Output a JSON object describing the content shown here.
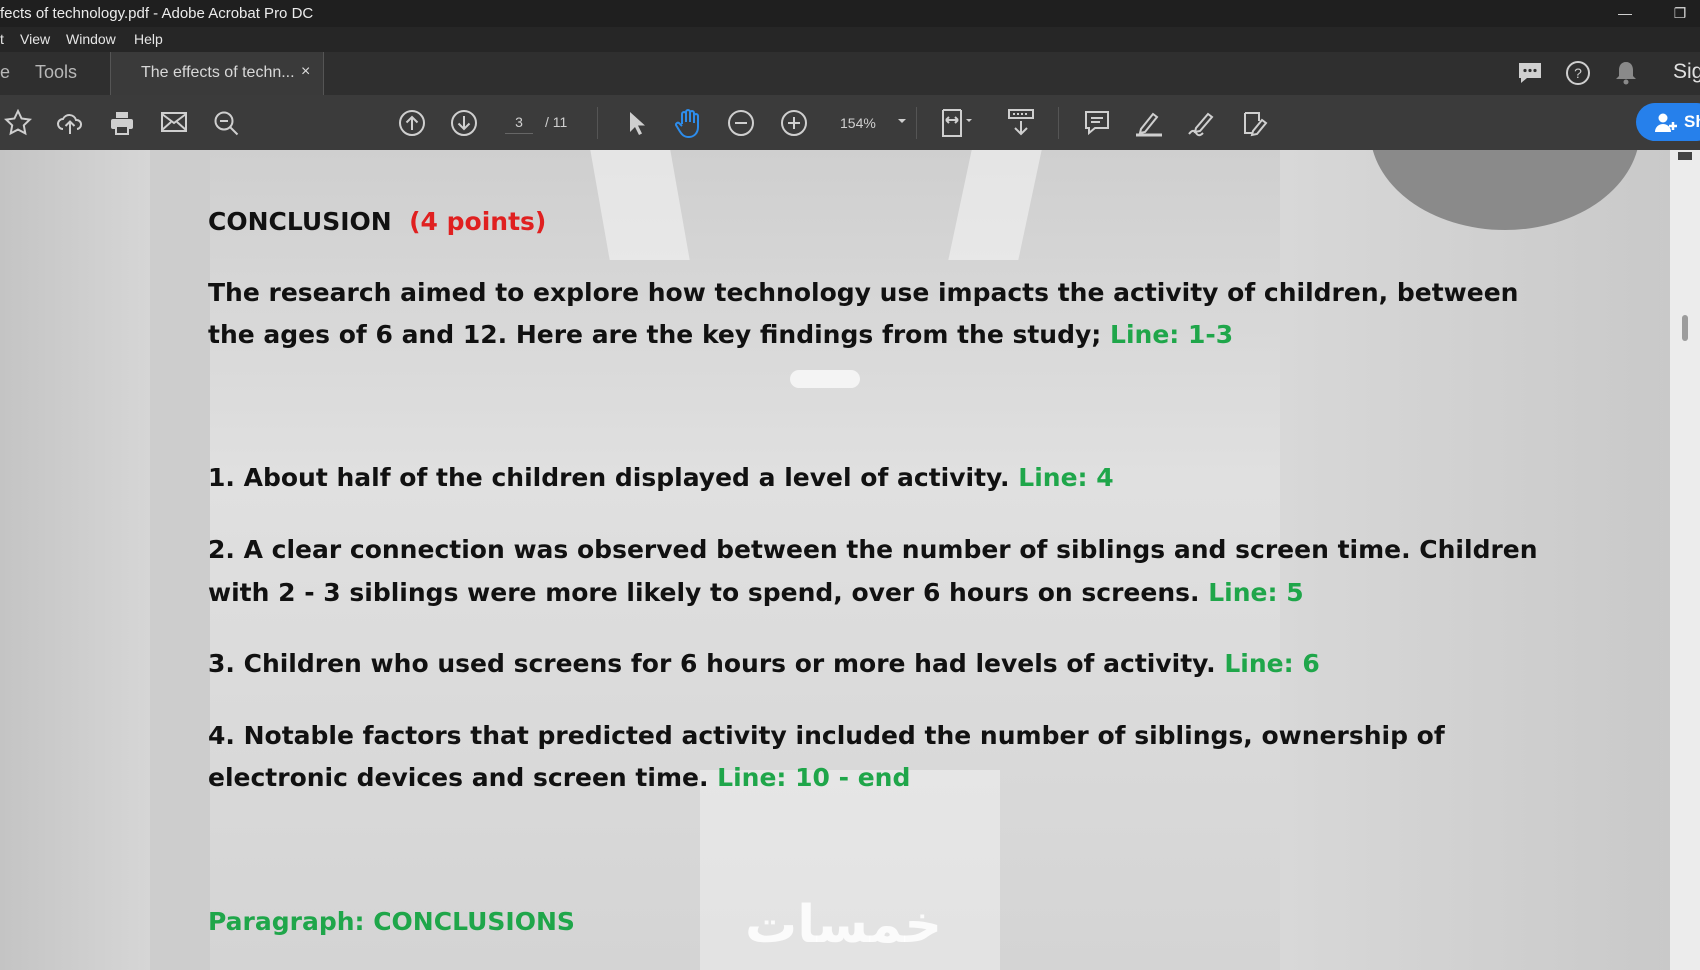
{
  "window": {
    "title": "fects of technology.pdf - Adobe Acrobat Pro DC",
    "minimize_glyph": "—",
    "restore_glyph": "❐"
  },
  "menu": {
    "items": [
      "t",
      "View",
      "Window",
      "Help"
    ]
  },
  "tabs": {
    "partial": "e",
    "tools": "Tools",
    "document": "The effects of techn...",
    "close": "×"
  },
  "header_right": {
    "sign_label": "Sig"
  },
  "toolbar": {
    "current_page": "3",
    "total_pages": "/ 11",
    "zoom": "154%",
    "share_label": "Sh"
  },
  "document": {
    "heading": "CONCLUSION",
    "points": "(4 points)",
    "intro_line1": "The research aimed to explore how technology use impacts the activity of children, between",
    "intro_line2": "the ages of 6 and 12. Here are the key findings from the study;",
    "intro_ref": "Line: 1-3",
    "f1": "1. About half of the children displayed a level of activity.",
    "f1_ref": "Line: 4",
    "f2_line1": "2. A clear connection was observed between the number of siblings and screen time. Children",
    "f2_line2": "with 2 - 3 siblings were more likely to spend, over 6 hours on screens.",
    "f2_ref": "Line: 5",
    "f3": "3. Children who used screens for 6 hours or more had levels of activity.",
    "f3_ref": "Line: 6",
    "f4_line1": "4. Notable factors that predicted activity included the number of siblings, ownership of",
    "f4_line2": "electronic devices and screen time.",
    "f4_ref": "Line: 10 - end",
    "paragraph_label": "Paragraph:  CONCLUSIONS",
    "watermark": "خمسات"
  },
  "colors": {
    "green": "#1fa64a",
    "red": "#e02020",
    "accent": "#2680eb"
  }
}
